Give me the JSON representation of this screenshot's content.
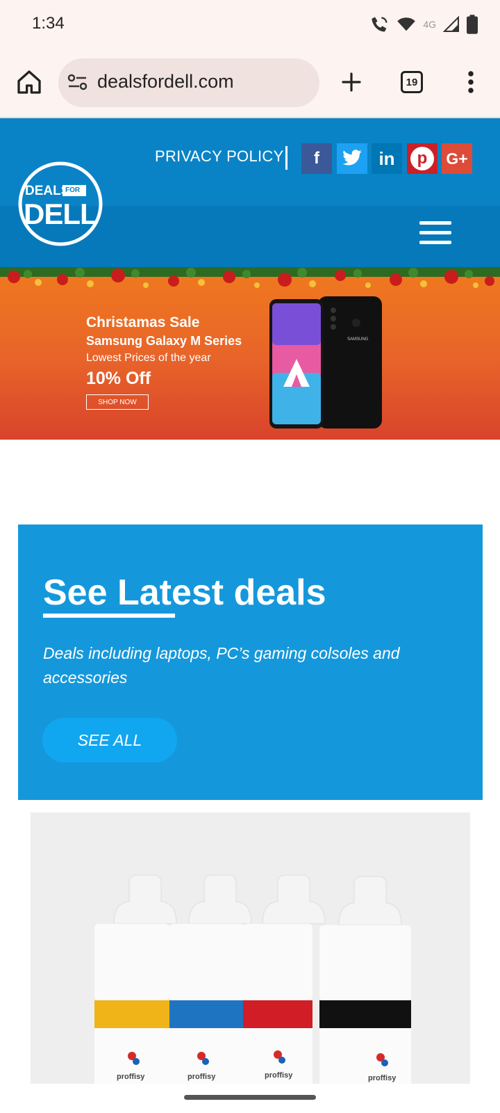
{
  "status_bar": {
    "time": "1:34",
    "network": "4G"
  },
  "browser": {
    "url": "dealsfordell.com",
    "tab_count": "19"
  },
  "site": {
    "privacy_label": "PRIVACY POLICY",
    "social": [
      "f",
      "t",
      "in",
      "p",
      "G+"
    ],
    "logo": {
      "top": "DEALS",
      "badge": "FOR",
      "bottom": "DELL"
    }
  },
  "banner": {
    "line1": "Christamas Sale",
    "line2": "Samsung Galaxy M Series",
    "line3": "Lowest Prices of the  year",
    "line4": "10% Off",
    "cta": "SHOP NOW",
    "phone_brand": "SAMSUNG"
  },
  "deals": {
    "title": "See Latest deals",
    "subtitle": "Deals including laptops, PC’s gaming colsoles and accessories",
    "cta": "SEE ALL"
  },
  "product": {
    "brand": "proffisy"
  },
  "colors": {
    "header": "#0a83c6",
    "nav": "#0679bb",
    "deals_panel": "#1598db",
    "button": "#11a7f0",
    "facebook": "#3b5998",
    "twitter": "#1da1f2",
    "linkedin": "#0077b5",
    "pinterest": "#cb2027",
    "google_plus": "#dd4b39"
  }
}
